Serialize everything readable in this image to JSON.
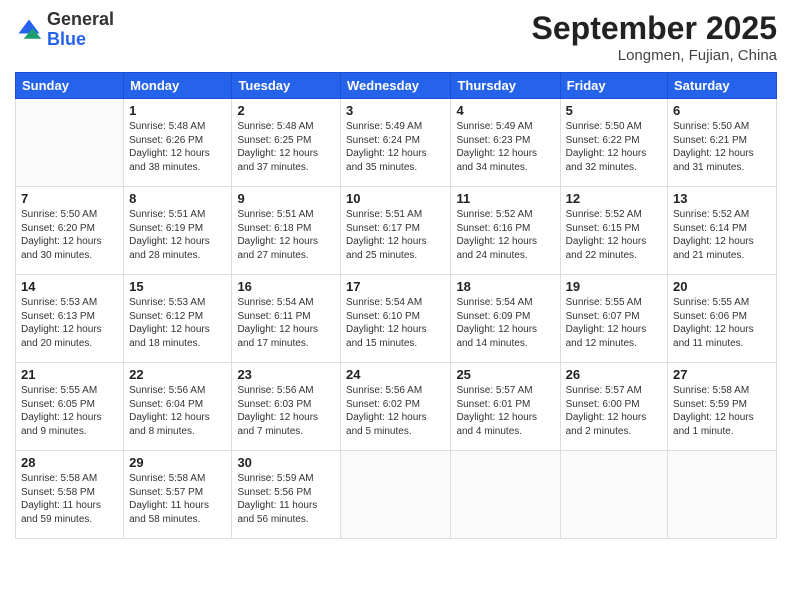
{
  "logo": {
    "general": "General",
    "blue": "Blue"
  },
  "header": {
    "month": "September 2025",
    "location": "Longmen, Fujian, China"
  },
  "weekdays": [
    "Sunday",
    "Monday",
    "Tuesday",
    "Wednesday",
    "Thursday",
    "Friday",
    "Saturday"
  ],
  "weeks": [
    [
      {
        "day": "",
        "sunrise": "",
        "sunset": "",
        "daylight": ""
      },
      {
        "day": "1",
        "sunrise": "Sunrise: 5:48 AM",
        "sunset": "Sunset: 6:26 PM",
        "daylight": "Daylight: 12 hours and 38 minutes."
      },
      {
        "day": "2",
        "sunrise": "Sunrise: 5:48 AM",
        "sunset": "Sunset: 6:25 PM",
        "daylight": "Daylight: 12 hours and 37 minutes."
      },
      {
        "day": "3",
        "sunrise": "Sunrise: 5:49 AM",
        "sunset": "Sunset: 6:24 PM",
        "daylight": "Daylight: 12 hours and 35 minutes."
      },
      {
        "day": "4",
        "sunrise": "Sunrise: 5:49 AM",
        "sunset": "Sunset: 6:23 PM",
        "daylight": "Daylight: 12 hours and 34 minutes."
      },
      {
        "day": "5",
        "sunrise": "Sunrise: 5:50 AM",
        "sunset": "Sunset: 6:22 PM",
        "daylight": "Daylight: 12 hours and 32 minutes."
      },
      {
        "day": "6",
        "sunrise": "Sunrise: 5:50 AM",
        "sunset": "Sunset: 6:21 PM",
        "daylight": "Daylight: 12 hours and 31 minutes."
      }
    ],
    [
      {
        "day": "7",
        "sunrise": "Sunrise: 5:50 AM",
        "sunset": "Sunset: 6:20 PM",
        "daylight": "Daylight: 12 hours and 30 minutes."
      },
      {
        "day": "8",
        "sunrise": "Sunrise: 5:51 AM",
        "sunset": "Sunset: 6:19 PM",
        "daylight": "Daylight: 12 hours and 28 minutes."
      },
      {
        "day": "9",
        "sunrise": "Sunrise: 5:51 AM",
        "sunset": "Sunset: 6:18 PM",
        "daylight": "Daylight: 12 hours and 27 minutes."
      },
      {
        "day": "10",
        "sunrise": "Sunrise: 5:51 AM",
        "sunset": "Sunset: 6:17 PM",
        "daylight": "Daylight: 12 hours and 25 minutes."
      },
      {
        "day": "11",
        "sunrise": "Sunrise: 5:52 AM",
        "sunset": "Sunset: 6:16 PM",
        "daylight": "Daylight: 12 hours and 24 minutes."
      },
      {
        "day": "12",
        "sunrise": "Sunrise: 5:52 AM",
        "sunset": "Sunset: 6:15 PM",
        "daylight": "Daylight: 12 hours and 22 minutes."
      },
      {
        "day": "13",
        "sunrise": "Sunrise: 5:52 AM",
        "sunset": "Sunset: 6:14 PM",
        "daylight": "Daylight: 12 hours and 21 minutes."
      }
    ],
    [
      {
        "day": "14",
        "sunrise": "Sunrise: 5:53 AM",
        "sunset": "Sunset: 6:13 PM",
        "daylight": "Daylight: 12 hours and 20 minutes."
      },
      {
        "day": "15",
        "sunrise": "Sunrise: 5:53 AM",
        "sunset": "Sunset: 6:12 PM",
        "daylight": "Daylight: 12 hours and 18 minutes."
      },
      {
        "day": "16",
        "sunrise": "Sunrise: 5:54 AM",
        "sunset": "Sunset: 6:11 PM",
        "daylight": "Daylight: 12 hours and 17 minutes."
      },
      {
        "day": "17",
        "sunrise": "Sunrise: 5:54 AM",
        "sunset": "Sunset: 6:10 PM",
        "daylight": "Daylight: 12 hours and 15 minutes."
      },
      {
        "day": "18",
        "sunrise": "Sunrise: 5:54 AM",
        "sunset": "Sunset: 6:09 PM",
        "daylight": "Daylight: 12 hours and 14 minutes."
      },
      {
        "day": "19",
        "sunrise": "Sunrise: 5:55 AM",
        "sunset": "Sunset: 6:07 PM",
        "daylight": "Daylight: 12 hours and 12 minutes."
      },
      {
        "day": "20",
        "sunrise": "Sunrise: 5:55 AM",
        "sunset": "Sunset: 6:06 PM",
        "daylight": "Daylight: 12 hours and 11 minutes."
      }
    ],
    [
      {
        "day": "21",
        "sunrise": "Sunrise: 5:55 AM",
        "sunset": "Sunset: 6:05 PM",
        "daylight": "Daylight: 12 hours and 9 minutes."
      },
      {
        "day": "22",
        "sunrise": "Sunrise: 5:56 AM",
        "sunset": "Sunset: 6:04 PM",
        "daylight": "Daylight: 12 hours and 8 minutes."
      },
      {
        "day": "23",
        "sunrise": "Sunrise: 5:56 AM",
        "sunset": "Sunset: 6:03 PM",
        "daylight": "Daylight: 12 hours and 7 minutes."
      },
      {
        "day": "24",
        "sunrise": "Sunrise: 5:56 AM",
        "sunset": "Sunset: 6:02 PM",
        "daylight": "Daylight: 12 hours and 5 minutes."
      },
      {
        "day": "25",
        "sunrise": "Sunrise: 5:57 AM",
        "sunset": "Sunset: 6:01 PM",
        "daylight": "Daylight: 12 hours and 4 minutes."
      },
      {
        "day": "26",
        "sunrise": "Sunrise: 5:57 AM",
        "sunset": "Sunset: 6:00 PM",
        "daylight": "Daylight: 12 hours and 2 minutes."
      },
      {
        "day": "27",
        "sunrise": "Sunrise: 5:58 AM",
        "sunset": "Sunset: 5:59 PM",
        "daylight": "Daylight: 12 hours and 1 minute."
      }
    ],
    [
      {
        "day": "28",
        "sunrise": "Sunrise: 5:58 AM",
        "sunset": "Sunset: 5:58 PM",
        "daylight": "Daylight: 11 hours and 59 minutes."
      },
      {
        "day": "29",
        "sunrise": "Sunrise: 5:58 AM",
        "sunset": "Sunset: 5:57 PM",
        "daylight": "Daylight: 11 hours and 58 minutes."
      },
      {
        "day": "30",
        "sunrise": "Sunrise: 5:59 AM",
        "sunset": "Sunset: 5:56 PM",
        "daylight": "Daylight: 11 hours and 56 minutes."
      },
      {
        "day": "",
        "sunrise": "",
        "sunset": "",
        "daylight": ""
      },
      {
        "day": "",
        "sunrise": "",
        "sunset": "",
        "daylight": ""
      },
      {
        "day": "",
        "sunrise": "",
        "sunset": "",
        "daylight": ""
      },
      {
        "day": "",
        "sunrise": "",
        "sunset": "",
        "daylight": ""
      }
    ]
  ]
}
